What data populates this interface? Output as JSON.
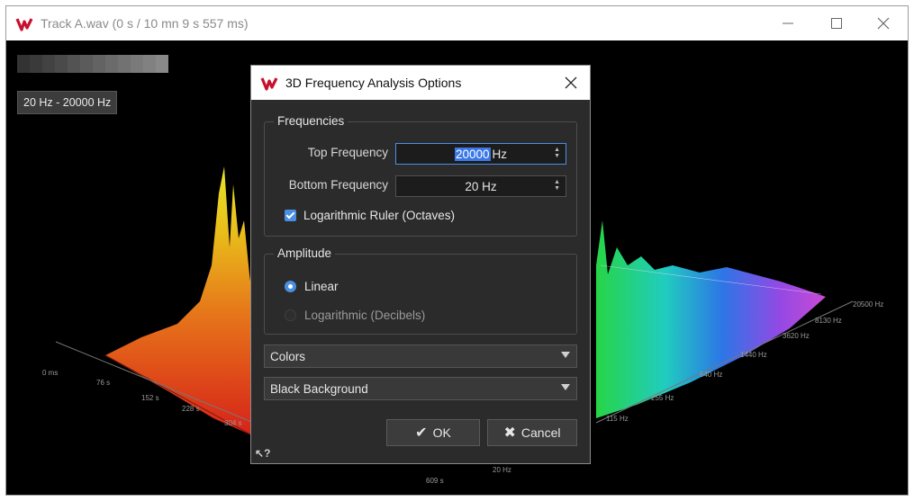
{
  "window": {
    "title": "Track A.wav (0 s / 10 mn 9 s 557 ms)",
    "logo_icon": "wavelab-logo-icon",
    "minimize_icon": "minimize-icon",
    "maximize_icon": "maximize-icon",
    "close_icon": "close-icon"
  },
  "viewer": {
    "range_label": "20 Hz - 20000 Hz",
    "time_ticks": [
      "0 ms",
      "76 s",
      "152 s",
      "228 s",
      "304 s",
      "609 s"
    ],
    "freq_ticks": [
      "20 Hz",
      "115 Hz",
      "255 Hz",
      "540 Hz",
      "1440 Hz",
      "3620 Hz",
      "8130 Hz",
      "20500 Hz"
    ]
  },
  "dialog": {
    "title": "3D Frequency Analysis Options",
    "frequencies": {
      "group_label": "Frequencies",
      "top_label": "Top Frequency",
      "top_value": "20000",
      "top_unit": "Hz",
      "bottom_label": "Bottom Frequency",
      "bottom_value": "20 Hz",
      "log_ruler_label": "Logarithmic Ruler (Octaves)",
      "log_ruler_checked": true
    },
    "amplitude": {
      "group_label": "Amplitude",
      "linear_label": "Linear",
      "log_label": "Logarithmic (Decibels)",
      "selected": "Linear"
    },
    "colors_select": "Colors",
    "background_select": "Black Background",
    "ok_label": "OK",
    "cancel_label": "Cancel",
    "help_label": "?"
  },
  "colors": {
    "accent": "#4a90e2",
    "dialog_bg": "#2b2b2b",
    "viewer_bg": "#000000"
  }
}
